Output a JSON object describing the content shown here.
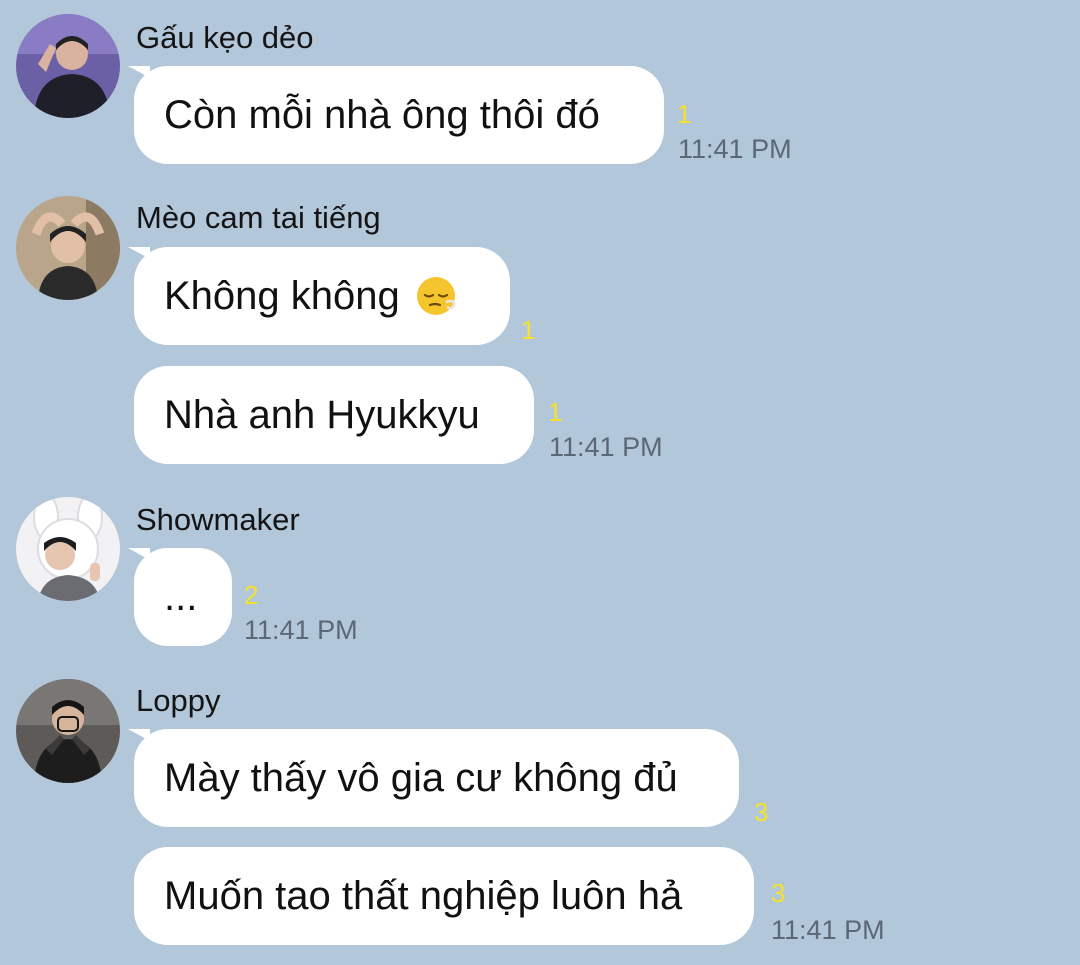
{
  "colors": {
    "background": "#b2c7da",
    "bubble": "#ffffff",
    "unread": "#f5e12b",
    "timestamp": "#5b6775"
  },
  "messages": [
    {
      "sender": "Gấu kẹo dẻo",
      "avatar_icon": "user-avatar-photo-icon",
      "bubbles": [
        {
          "text": "Còn mỗi nhà ông thôi đó",
          "unread": "1",
          "time": "11:41 PM"
        }
      ]
    },
    {
      "sender": "Mèo cam tai tiếng",
      "avatar_icon": "user-avatar-photo-icon",
      "bubbles": [
        {
          "text": "Không không",
          "emoji": "sleepy-face-emoji-icon",
          "unread": "1"
        },
        {
          "text": "Nhà anh Hyukkyu",
          "unread": "1",
          "time": "11:41 PM"
        }
      ]
    },
    {
      "sender": "Showmaker",
      "avatar_icon": "user-avatar-photo-icon",
      "bubbles": [
        {
          "text": "...",
          "unread": "2",
          "time": "11:41 PM"
        }
      ]
    },
    {
      "sender": "Loppy",
      "avatar_icon": "user-avatar-photo-icon",
      "bubbles": [
        {
          "text": "Mày thấy vô gia cư không đủ",
          "unread": "3"
        },
        {
          "text": "Muốn tao thất nghiệp luôn hả",
          "unread": "3",
          "time": "11:41 PM"
        }
      ]
    }
  ]
}
